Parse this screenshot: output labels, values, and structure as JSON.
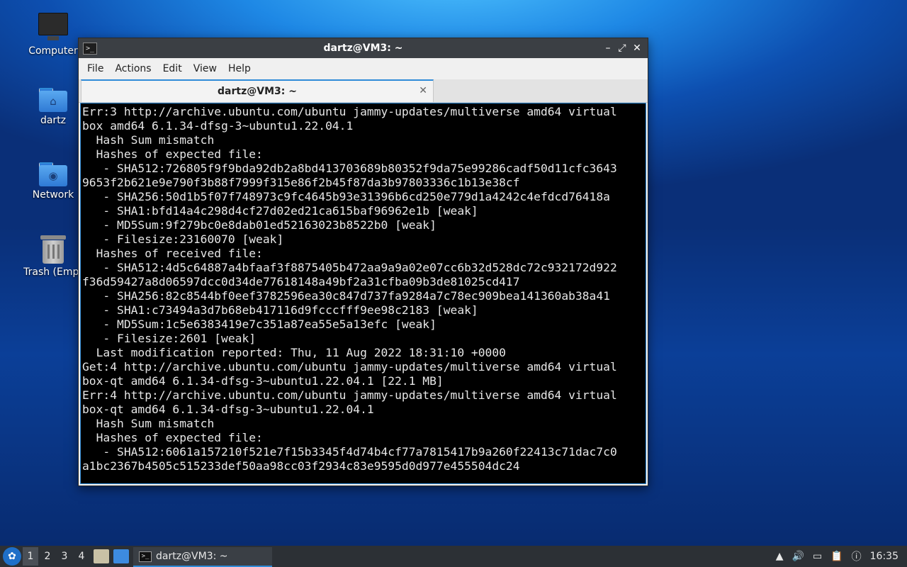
{
  "desktop": {
    "icons": [
      {
        "label": "Computer"
      },
      {
        "label": "dartz"
      },
      {
        "label": "Network"
      },
      {
        "label": "Trash (Empt"
      }
    ]
  },
  "window": {
    "title": "dartz@VM3: ~",
    "controls": {
      "minimize": "–",
      "maximize": "⤢",
      "close": "✕"
    },
    "menu": [
      "File",
      "Actions",
      "Edit",
      "View",
      "Help"
    ],
    "tab": {
      "label": "dartz@VM3: ~",
      "close": "✕"
    },
    "terminal_text": "Err:3 http://archive.ubuntu.com/ubuntu jammy-updates/multiverse amd64 virtual\nbox amd64 6.1.34-dfsg-3~ubuntu1.22.04.1\n  Hash Sum mismatch\n  Hashes of expected file:\n   - SHA512:726805f9f9bda92db2a8bd413703689b80352f9da75e99286cadf50d11cfc3643\n9653f2b621e9e790f3b88f7999f315e86f2b45f87da3b97803336c1b13e38cf\n   - SHA256:50d1b5f07f748973c9fc4645b93e31396b6cd250e779d1a4242c4efdcd76418a\n   - SHA1:bfd14a4c298d4cf27d02ed21ca615baf96962e1b [weak]\n   - MD5Sum:9f279bc0e8dab01ed52163023b8522b0 [weak]\n   - Filesize:23160070 [weak]\n  Hashes of received file:\n   - SHA512:4d5c64887a4bfaaf3f8875405b472aa9a9a02e07cc6b32d528dc72c932172d922\nf36d59427a8d06597dcc0d34de77618148a49bf2a31cfba09b3de81025cd417\n   - SHA256:82c8544bf0eef3782596ea30c847d737fa9284a7c78ec909bea141360ab38a41\n   - SHA1:c73494a3d7b68eb417116d9fcccfff9ee98c2183 [weak]\n   - MD5Sum:1c5e6383419e7c351a87ea55e5a13efc [weak]\n   - Filesize:2601 [weak]\n  Last modification reported: Thu, 11 Aug 2022 18:31:10 +0000\nGet:4 http://archive.ubuntu.com/ubuntu jammy-updates/multiverse amd64 virtual\nbox-qt amd64 6.1.34-dfsg-3~ubuntu1.22.04.1 [22.1 MB]\nErr:4 http://archive.ubuntu.com/ubuntu jammy-updates/multiverse amd64 virtual\nbox-qt amd64 6.1.34-dfsg-3~ubuntu1.22.04.1\n  Hash Sum mismatch\n  Hashes of expected file:\n   - SHA512:6061a157210f521e7f15b3345f4d74b4cf77a7815417b9a260f22413c71dac7c0\na1bc2367b4505c515233def50aa98cc03f2934c83e9595d0d977e455504dc24"
  },
  "taskbar": {
    "workspaces": [
      "1",
      "2",
      "3",
      "4"
    ],
    "task_label": "dartz@VM3: ~",
    "clock": "16:35"
  },
  "colors": {
    "accent": "#2f8bd8",
    "titlebar": "#3b3f44",
    "taskbar": "#2c3035"
  }
}
